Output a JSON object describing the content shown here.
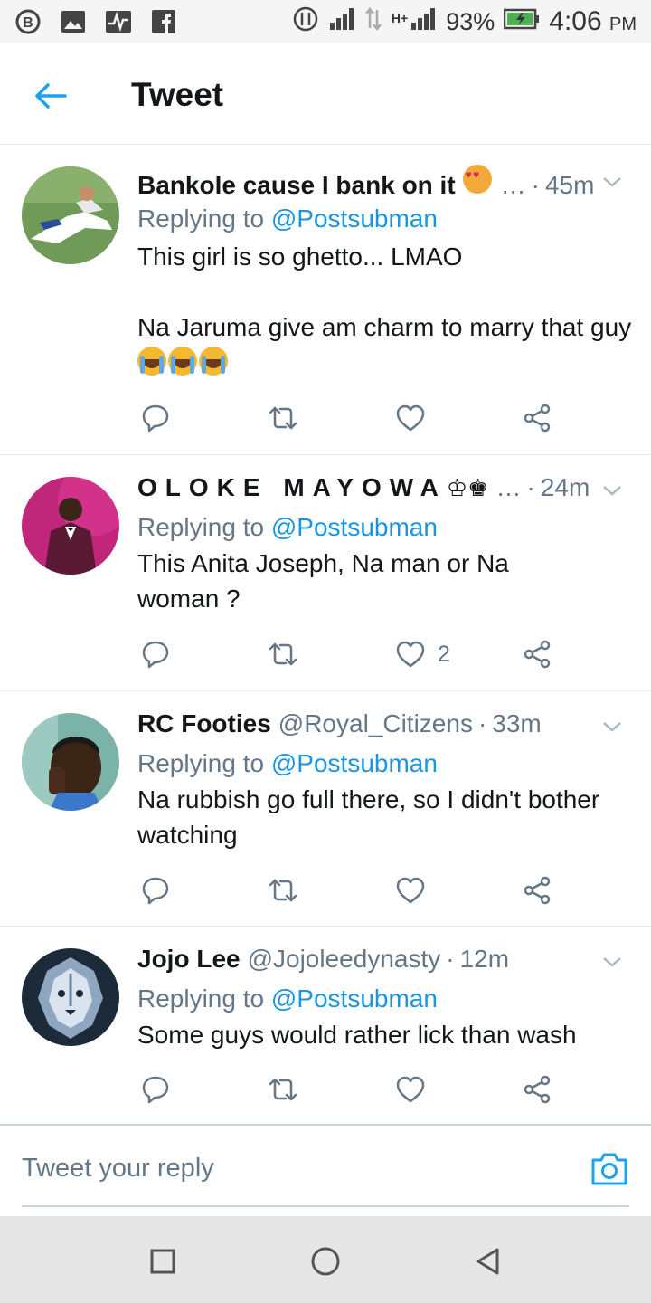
{
  "status_bar": {
    "battery": "93%",
    "time": "4:06",
    "ampm": "PM",
    "network": "H+",
    "icons": [
      "b-badge-icon",
      "image-icon",
      "pulse-icon",
      "facebook-icon",
      "data-icon",
      "signal-icon",
      "battery-icon"
    ]
  },
  "header": {
    "title": "Tweet"
  },
  "tweets": [
    {
      "name": "Bankole cause I bank on it",
      "handle": "…",
      "time": "45m",
      "reply_prefix": "Replying to",
      "reply_to": "@Postsubman",
      "text": "This girl is so ghetto... LMAO\n\nNa Jaruma give am charm to marry that guy",
      "likes": ""
    },
    {
      "name": "OLOKE MAYOWA",
      "handle": "…",
      "time": "24m",
      "reply_prefix": "Replying to",
      "reply_to": "@Postsubman",
      "text": "This Anita Joseph, Na man or Na woman ?",
      "likes": "2"
    },
    {
      "name": "RC Footies",
      "handle": "@Royal_Citizens",
      "time": "33m",
      "reply_prefix": "Replying to",
      "reply_to": "@Postsubman",
      "text": "Na rubbish go full there, so I didn't bother watching",
      "likes": ""
    },
    {
      "name": "Jojo Lee",
      "handle": "@Jojoleedynasty",
      "time": "12m",
      "reply_prefix": "Replying to",
      "reply_to": "@Postsubman",
      "text": "Some guys would rather lick than wash",
      "likes": ""
    }
  ],
  "reply_bar": {
    "placeholder": "Tweet your reply"
  },
  "colors": {
    "accent": "#1da1f2",
    "link": "#1b95e0",
    "muted": "#657786",
    "divider": "#e1e8ed"
  }
}
